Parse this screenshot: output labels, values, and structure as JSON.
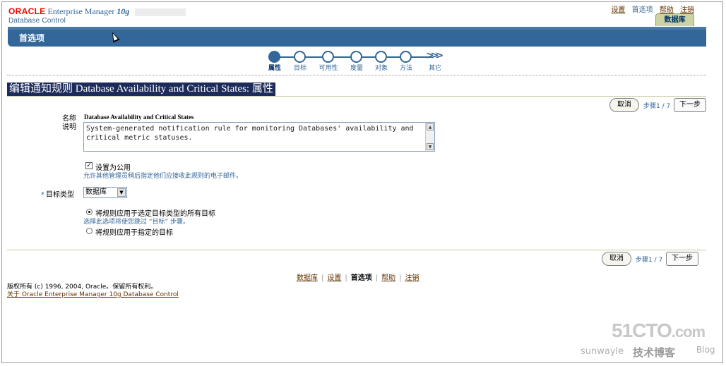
{
  "brand": {
    "oracle": "ORACLE",
    "product": "Enterprise Manager",
    "version": "10g",
    "subtitle": "Database Control"
  },
  "global_links": [
    "设置",
    "首选项",
    "帮助",
    "注销"
  ],
  "database_tab": "数据库",
  "nav_title": "首选项",
  "train": {
    "steps": [
      "属性",
      "目标",
      "可用性",
      "度量",
      "对象",
      "方法",
      "其它"
    ],
    "current_index": 0
  },
  "page_title": "编辑通知规则 Database Availability and Critical States: 属性",
  "actions": {
    "cancel": "取消",
    "step": "步骤1 / 7",
    "next": "下一步"
  },
  "form": {
    "name_label": "名称",
    "name_value": "Database Availability and Critical States",
    "desc_label": "说明",
    "desc_value": "System-generated notification rule for monitoring Databases' availability and critical metric statuses.",
    "public_checked": true,
    "public_label": "设置为公用",
    "public_hint": "允许其他管理员稍后指定他们应接收此规则的电子邮件。",
    "target_type_label": "目标类型",
    "target_type_value": "数据库",
    "radio_all_label": "将规则应用于选定目标类型的所有目标",
    "radio_all_hint": "选择此选项将使您跳过 “目标” 步骤。",
    "radio_specific_label": "将规则应用于指定的目标",
    "radio_selected": "all"
  },
  "footer": {
    "links": [
      "数据库",
      "设置",
      "首选项",
      "帮助",
      "注销"
    ],
    "current": "首选项",
    "copyright": "版权所有 (c) 1996, 2004, Oracle。保留所有权利。",
    "about": "关于 Oracle Enterprise Manager 10g Database Control"
  },
  "watermark": {
    "site": "51CTO",
    "domain": ".com",
    "user": "sunwayle",
    "blog_cn": "技术博客",
    "blog_en": "Blog"
  }
}
